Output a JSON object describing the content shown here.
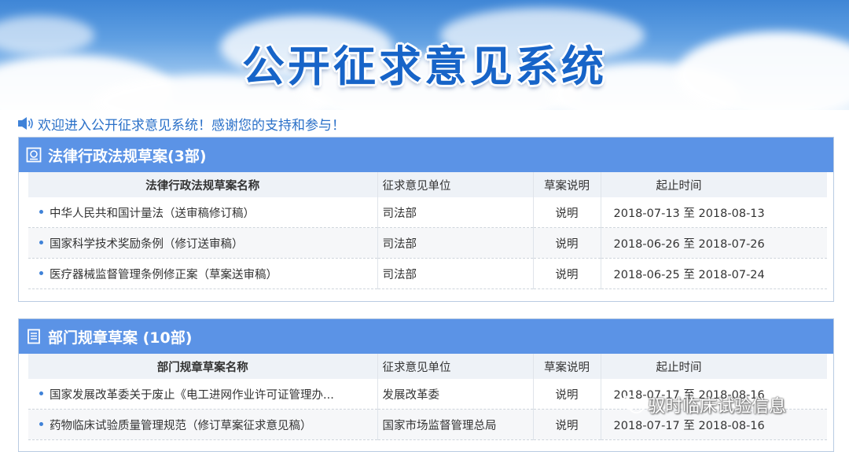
{
  "banner": {
    "title": "公开征求意见系统"
  },
  "welcome": {
    "text": "欢迎进入公开征求意见系统！感谢您的支持和参与！"
  },
  "panels": [
    {
      "title": "法律行政法规草案(3部)",
      "headers": [
        "法律行政法规草案名称",
        "征求意见单位",
        "草案说明",
        "起止时间"
      ],
      "rows": [
        {
          "name": "中华人民共和国计量法（送审稿修订稿）",
          "unit": "司法部",
          "note": "说明",
          "period": "2018-07-13 至 2018-08-13"
        },
        {
          "name": "国家科学技术奖励条例（修订送审稿）",
          "unit": "司法部",
          "note": "说明",
          "period": "2018-06-26 至 2018-07-26"
        },
        {
          "name": "医疗器械监督管理条例修正案（草案送审稿）",
          "unit": "司法部",
          "note": "说明",
          "period": "2018-06-25 至 2018-07-24"
        }
      ]
    },
    {
      "title": "部门规章草案 (10部)",
      "headers": [
        "部门规章草案名称",
        "征求意见单位",
        "草案说明",
        "起止时间"
      ],
      "rows": [
        {
          "name": "国家发展改革委关于废止《电工进网作业许可证管理办...",
          "unit": "发展改革委",
          "note": "说明",
          "period": "2018-07-17 至 2018-08-16"
        },
        {
          "name": "药物临床试验质量管理规范（修订草案征求意见稿）",
          "unit": "国家市场监督管理总局",
          "note": "说明",
          "period": "2018-07-17 至 2018-08-16"
        }
      ]
    }
  ],
  "watermark": {
    "text": "驭时临床试验信息"
  },
  "colors": {
    "header_bar": "#5b93e6",
    "title_blue": "#1764c8",
    "welcome_blue": "#2a70c8",
    "bullet": "#3f82d8"
  },
  "icons": {
    "welcome": "speaker-icon",
    "panel1": "seal-icon",
    "panel2": "document-icon",
    "watermark": "wechat-icon"
  }
}
